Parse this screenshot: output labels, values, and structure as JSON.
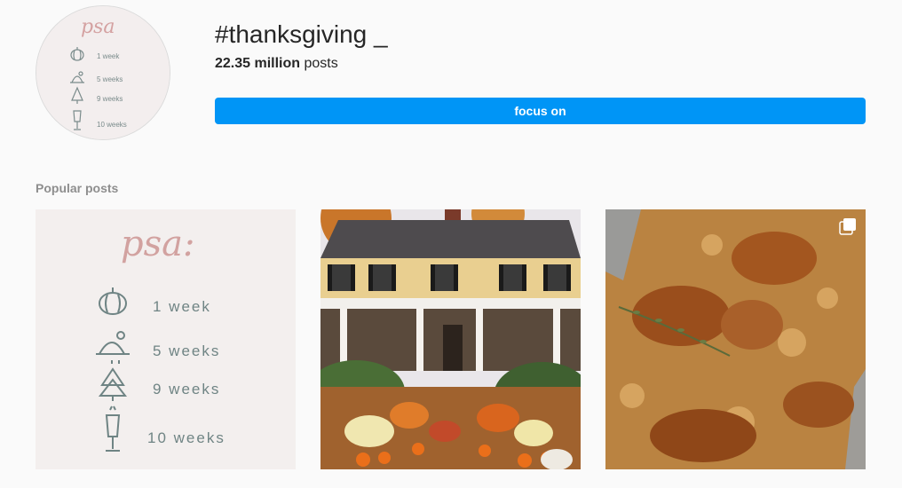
{
  "header": {
    "avatar_lines": [
      "psa",
      "1 week",
      "5 weeks",
      "9 weeks",
      "10 weeks"
    ],
    "title": "#thanksgiving _",
    "post_count_value": "22.35 million",
    "post_count_suffix": " posts",
    "follow_label": "focus on"
  },
  "section": {
    "title": "Popular posts"
  },
  "posts": [
    {
      "kind": "graphic",
      "lines": [
        "psa:",
        "1 week",
        "5 weeks",
        "9 weeks",
        "10 weeks"
      ],
      "icons": [
        "pumpkin-icon",
        "turkey-icon",
        "tree-icon",
        "champagne-icon"
      ]
    },
    {
      "kind": "photo",
      "subject": "house-with-autumn-decorations"
    },
    {
      "kind": "photo",
      "subject": "roasted-chicken",
      "badge_icon": "carousel-icon"
    }
  ],
  "colors": {
    "accent": "#0095f6",
    "text": "#262626",
    "muted": "#8e8e8e",
    "background": "#fafafa"
  }
}
